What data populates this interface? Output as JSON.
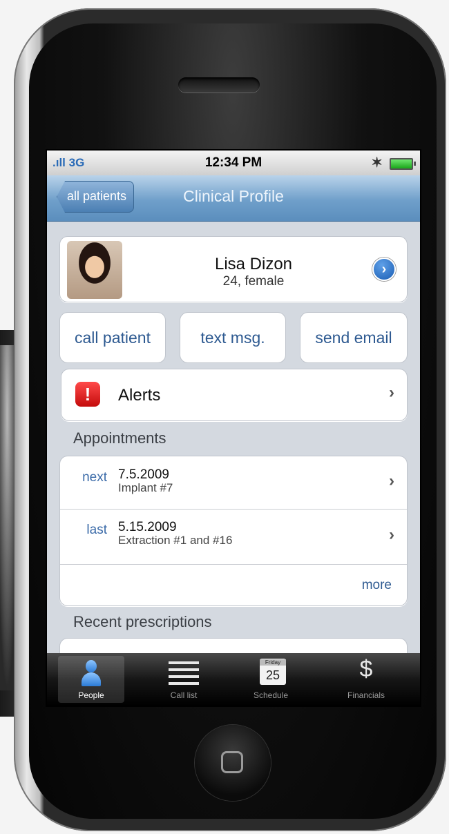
{
  "status_bar": {
    "signal": ".ıll 3G",
    "time": "12:34 PM",
    "bluetooth_icon": "bluetooth-icon",
    "battery_icon": "battery-icon"
  },
  "nav": {
    "back_label": "all patients",
    "title": "Clinical Profile"
  },
  "patient": {
    "name": "Lisa Dizon",
    "info": "24, female",
    "detail_icon": "›"
  },
  "actions": [
    "call patient",
    "text msg.",
    "send email"
  ],
  "alerts": {
    "icon": "!",
    "label": "Alerts",
    "chevron": "›"
  },
  "appointments": {
    "header": "Appointments",
    "rows": [
      {
        "kind": "next",
        "date": "7.5.2009",
        "desc": "Implant #7",
        "chevron": "›"
      },
      {
        "kind": "last",
        "date": "5.15.2009",
        "desc": "Extraction #1 and #16",
        "chevron": "›"
      }
    ],
    "more": "more"
  },
  "prescriptions": {
    "header": "Recent prescriptions"
  },
  "tab_bar": {
    "tabs": [
      {
        "label": "People",
        "icon": "people-icon",
        "active": true
      },
      {
        "label": "Call list",
        "icon": "list-icon",
        "active": false
      },
      {
        "label": "Schedule",
        "icon": "calendar-icon",
        "active": false,
        "cal_day": "Friday",
        "cal_date": "25"
      },
      {
        "label": "Financials",
        "icon": "dollar-icon",
        "active": false,
        "glyph": "$"
      }
    ]
  },
  "colors": {
    "nav_blue": "#6f9fca",
    "link_blue": "#2e5a91",
    "alert_red": "#c40b0b"
  }
}
